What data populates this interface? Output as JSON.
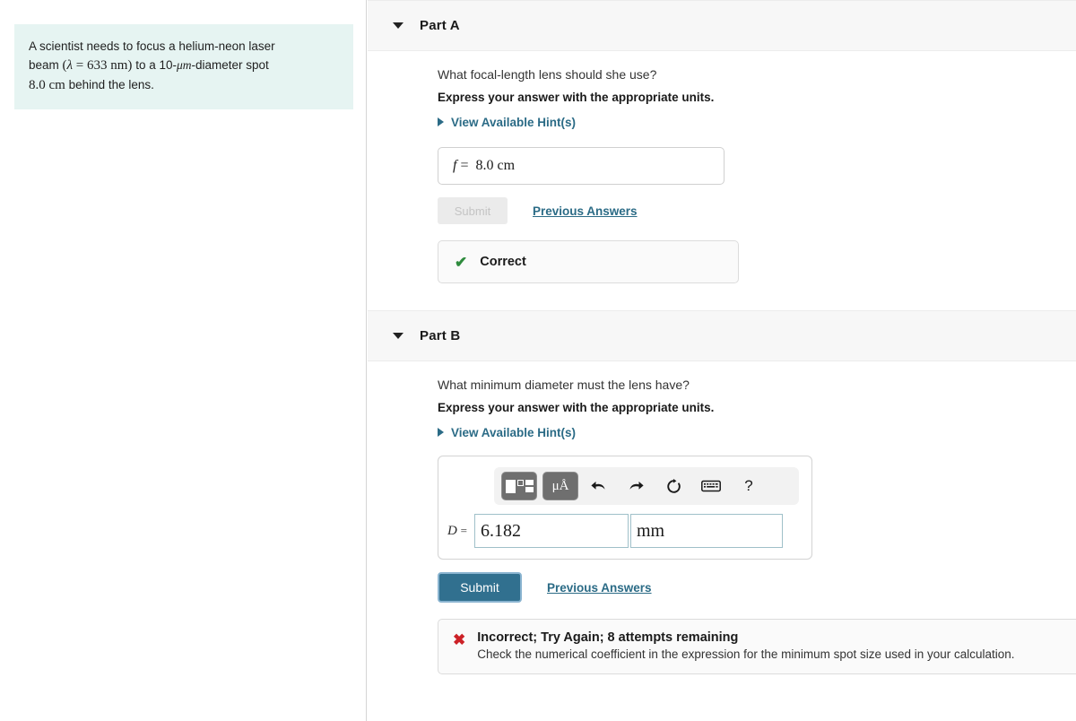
{
  "problem": {
    "line1": "A scientist needs to focus a helium-neon laser",
    "line2_pre": "beam",
    "line2_math": "(λ = 633 nm)",
    "line2_mid": "to a 10-",
    "line2_mu": "μm",
    "line2_post": "-diameter spot",
    "line3_math": "8.0 cm",
    "line3_post": "behind the lens."
  },
  "partA": {
    "title": "Part A",
    "question": "What focal-length lens should she use?",
    "instruction": "Express your answer with the appropriate units.",
    "hint_label": "View Available Hint(s)",
    "answer_var": "f",
    "answer_eq": "=",
    "answer_value": "8.0 cm",
    "submit_label": "Submit",
    "previous_answers_label": "Previous Answers",
    "feedback_icon": "check-icon",
    "feedback_title": "Correct"
  },
  "partB": {
    "title": "Part B",
    "question": "What minimum diameter must the lens have?",
    "instruction": "Express your answer with the appropriate units.",
    "hint_label": "View Available Hint(s)",
    "toolbar": [
      {
        "name": "math-template-button",
        "label": ""
      },
      {
        "name": "units-button",
        "label": "μÅ"
      },
      {
        "name": "undo-button",
        "label": "⬅"
      },
      {
        "name": "redo-button",
        "label": "➡"
      },
      {
        "name": "reset-button",
        "label": "↻"
      },
      {
        "name": "keyboard-button",
        "label": "⌨"
      },
      {
        "name": "help-button",
        "label": "?"
      }
    ],
    "answer_var": "D",
    "answer_eq": "=",
    "answer_value": "6.182",
    "answer_unit": "mm",
    "submit_label": "Submit",
    "previous_answers_label": "Previous Answers",
    "feedback_icon": "x-icon",
    "feedback_title": "Incorrect; Try Again; 8 attempts remaining",
    "feedback_sub": "Check the numerical coefficient in the expression for the minimum spot size used in your calculation."
  },
  "colors": {
    "problem_bg": "#e6f4f2",
    "link": "#2b6b86",
    "submit_blue": "#31708f",
    "correct_green": "#2e8b3d",
    "incorrect_red": "#cc2127",
    "header_band": "#f7f7f7"
  }
}
